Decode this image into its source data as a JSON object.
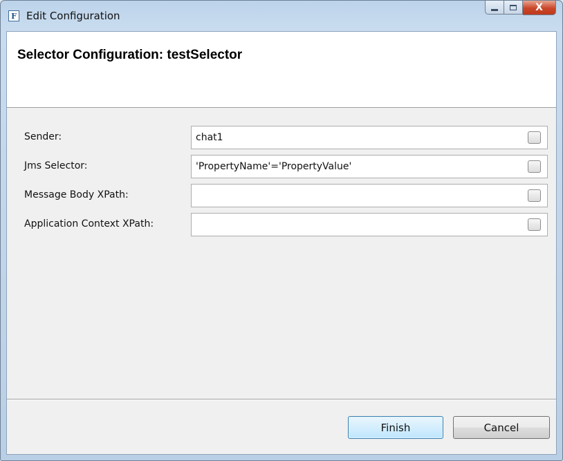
{
  "window": {
    "title": "Edit Configuration",
    "app_icon_letter": "F",
    "close_glyph": "X"
  },
  "header": {
    "title": "Selector Configuration: testSelector"
  },
  "form": {
    "fields": [
      {
        "label": "Sender:",
        "value": "chat1"
      },
      {
        "label": "Jms Selector:",
        "value": "'PropertyName'='PropertyValue'"
      },
      {
        "label": "Message Body XPath:",
        "value": ""
      },
      {
        "label": "Application Context XPath:",
        "value": ""
      }
    ]
  },
  "buttons": {
    "finish": "Finish",
    "cancel": "Cancel"
  },
  "colors": {
    "client_background": "#f0f0f0",
    "header_background": "#ffffff",
    "close_button": "#c9472a",
    "default_button_border": "#3c7fb1"
  },
  "icons": {
    "app": "app-logo-icon",
    "minimize": "minimize-icon",
    "maximize": "maximize-icon",
    "close": "close-icon",
    "field_toggle": "checkbox-icon"
  }
}
